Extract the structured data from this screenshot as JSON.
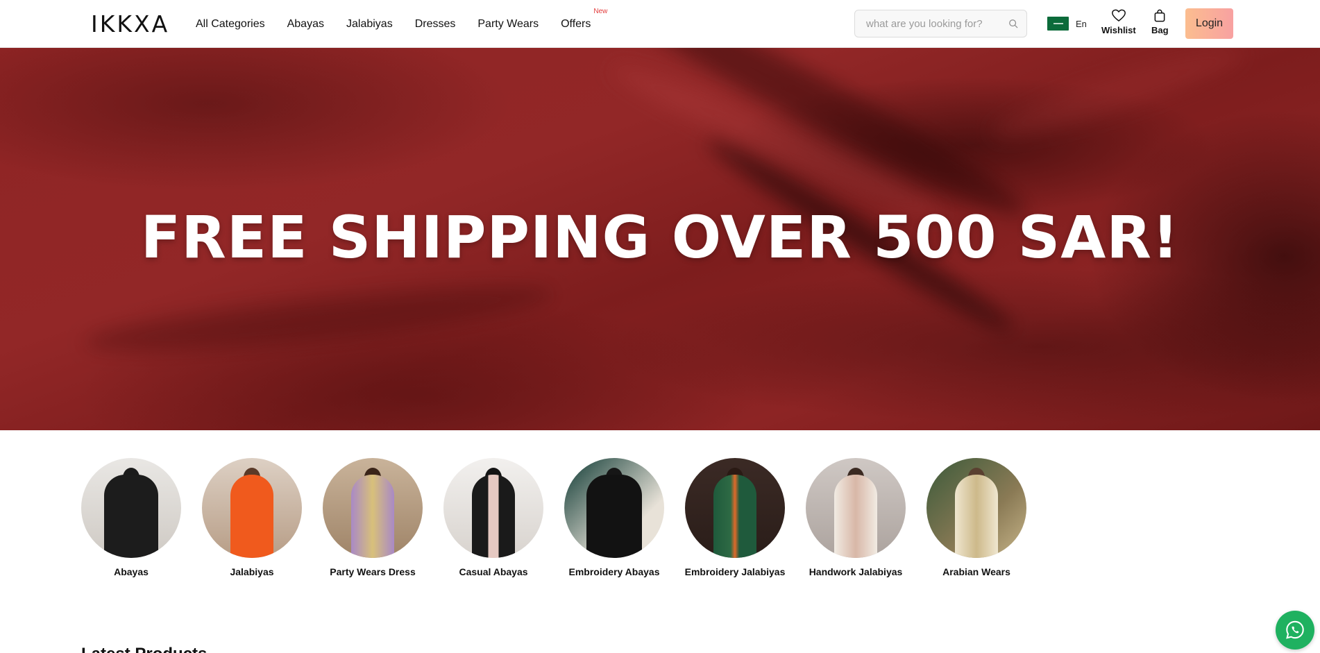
{
  "brand": {
    "logo_text": "IKKXA"
  },
  "nav": {
    "items": [
      {
        "label": "All Categories"
      },
      {
        "label": "Abayas"
      },
      {
        "label": "Jalabiyas"
      },
      {
        "label": "Dresses"
      },
      {
        "label": "Party Wears"
      },
      {
        "label": "Offers",
        "badge": "New"
      }
    ]
  },
  "search": {
    "placeholder": "what are you looking for?",
    "value": "",
    "icon": "search-icon"
  },
  "language": {
    "label": "En",
    "flag": "saudi-flag-icon"
  },
  "header_actions": {
    "wishlist_label": "Wishlist",
    "bag_label": "Bag",
    "login_label": "Login"
  },
  "hero": {
    "headline": "FREE SHIPPING OVER 500 SAR!"
  },
  "categories": [
    {
      "label": "Abayas"
    },
    {
      "label": "Jalabiyas"
    },
    {
      "label": "Party Wears Dress"
    },
    {
      "label": "Casual Abayas"
    },
    {
      "label": "Embroidery Abayas"
    },
    {
      "label": "Embroidery Jalabiyas"
    },
    {
      "label": "Handwork Jalabiyas"
    },
    {
      "label": "Arabian Wears"
    }
  ],
  "sections": {
    "latest_title": "Latest Products"
  },
  "colors": {
    "accent_gradient_start": "#fbbd8f",
    "accent_gradient_end": "#f8a1a1",
    "hero_red": "#8f2424",
    "offer_badge": "#e23b3b",
    "whatsapp_green": "#1fb160"
  }
}
